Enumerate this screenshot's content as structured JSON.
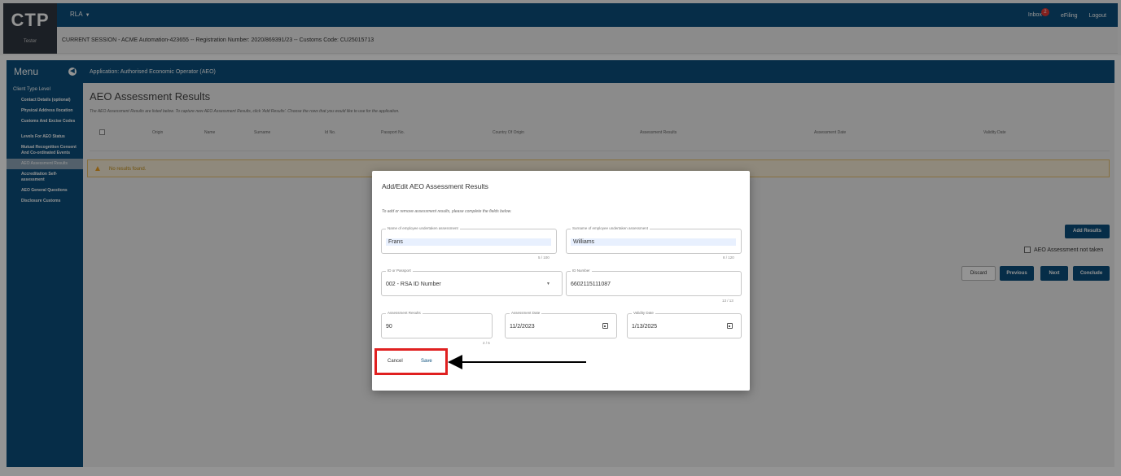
{
  "header": {
    "logo_text": "CTP",
    "logo_subtext": "Tester",
    "user_menu": "RLA",
    "inbox_label": "Inbox",
    "inbox_count": "2",
    "efiling_label": "eFiling",
    "logout_label": "Logout",
    "session_text": "CURRENT SESSION - ACME Automation-423655 -- Registration Number: 2020/869391/23 -- Customs Code: CU25015713"
  },
  "sidebar": {
    "title": "Menu",
    "level_label": "Client Type Level",
    "items": [
      {
        "label": "Contact Details (optional)"
      },
      {
        "label": "Physical Address /location"
      },
      {
        "label": "Customs And Excise Codes"
      },
      {
        "label": "Levels For AEO Status"
      },
      {
        "label": "Mutual Recognition Consent And Co-ordinated Events"
      },
      {
        "label": "AEO Assessment Results"
      },
      {
        "label": "Accreditation Self-assessment"
      },
      {
        "label": "AEO General Questions"
      },
      {
        "label": "Disclosure Customs"
      }
    ]
  },
  "app": {
    "title": "Application: Authorised Economic Operator (AEO)"
  },
  "main": {
    "heading": "AEO Assessment Results",
    "description": "The AEO Assessment Results are listed below. To capture new AEO Assessment Results, click 'Add Results'. Choose the rows that you would like to use for the application.",
    "columns": [
      "Origin",
      "Name",
      "Surname",
      "Id No.",
      "Passport No.",
      "Country Of Origin",
      "Assessment Results",
      "Assessment Date",
      "Validity Date"
    ],
    "no_results": "No results found.",
    "add_results": "Add Results",
    "not_taken_label": "AEO Assessment not taken",
    "discard": "Discard",
    "previous": "Previous",
    "next": "Next",
    "conclude": "Conclude"
  },
  "dialog": {
    "title": "Add/Edit AEO Assessment Results",
    "subtitle": "To add or remove assessment results, please complete the fields below.",
    "name_label": "Name of employee undertaken assessment",
    "name_value": "Frans",
    "name_counter": "5 / 100",
    "surname_label": "Surname of employee undertaken assessment",
    "surname_value": "Williams",
    "surname_counter": "8 / 120",
    "id_passport_label": "ID or Passport",
    "id_passport_value": "002 - RSA ID Number",
    "id_number_label": "ID Number",
    "id_number_value": "6602115111087",
    "id_number_counter": "13 / 13",
    "results_label": "Assessment Results",
    "results_value": "90",
    "results_counter": "2 / 5",
    "assessment_date_label": "Assessment Date",
    "assessment_date_value": "11/2/2023",
    "validity_date_label": "Validity Date",
    "validity_date_value": "1/13/2025",
    "cancel_label": "Cancel",
    "save_label": "Save"
  },
  "colors": {
    "primary": "#0b4f7c",
    "highlight_box": "#e02020",
    "warning_bg": "#f6ecd6"
  }
}
